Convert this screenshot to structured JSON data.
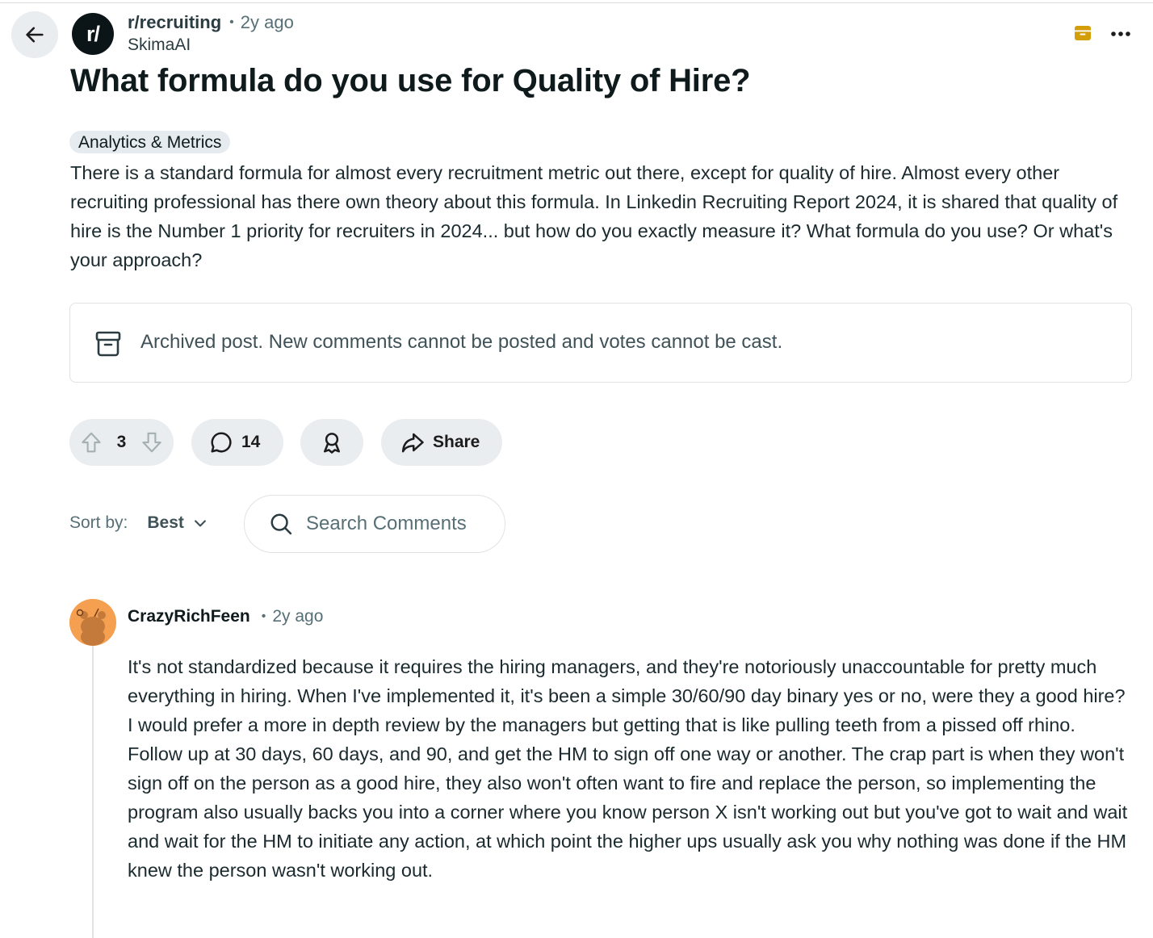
{
  "post": {
    "subreddit": "r/recruiting",
    "time_ago": "2y ago",
    "author": "SkimaAI",
    "title": "What formula do you use for Quality of Hire?",
    "flair": "Analytics & Metrics",
    "body": "There is a standard formula for almost every recruitment metric out there, except for quality of hire. Almost every other recruiting professional has there own theory about this formula. In Linkedin Recruiting Report 2024, it is shared that quality of hire is the Number 1 priority for recruiters in 2024... but how do you exactly measure it? What formula do you use? Or what's your approach?",
    "avatar_text": "r/"
  },
  "archived_notice": "Archived post. New comments cannot be posted and votes cannot be cast.",
  "actions": {
    "vote_count": "3",
    "comment_count": "14",
    "share_label": "Share"
  },
  "sort": {
    "label": "Sort by:",
    "value": "Best"
  },
  "search": {
    "placeholder": "Search Comments"
  },
  "comment": {
    "author": "CrazyRichFeen",
    "time_ago": "2y ago",
    "text": "It's not standardized because it requires the hiring managers, and they're notoriously unaccountable for pretty much everything in hiring. When I've implemented it, it's been a simple 30/60/90 day binary yes or no, were they a good hire? I would prefer a more in depth review by the managers but getting that is like pulling teeth from a pissed off rhino. Follow up at 30 days, 60 days, and 90, and get the HM to sign off one way or another. The crap part is when they won't sign off on the person as a good hire, they also won't often want to fire and replace the person, so implementing the program also usually backs you into a corner where you know person X isn't working out but you've got to wait and wait and wait for the HM to initiate any action, at which point the higher ups usually ask you why nothing was done if the HM knew the person wasn't working out."
  },
  "icons": [
    "back-arrow-icon",
    "archive-icon",
    "more-options-icon",
    "upvote-icon",
    "downvote-icon",
    "comment-icon",
    "award-icon",
    "share-icon",
    "chevron-down-icon",
    "search-icon",
    "user-avatar"
  ],
  "colors": {
    "archive_accent": "#d49e0b",
    "pill_bg": "#eaedef",
    "avatar_bg": "#f5a051"
  }
}
